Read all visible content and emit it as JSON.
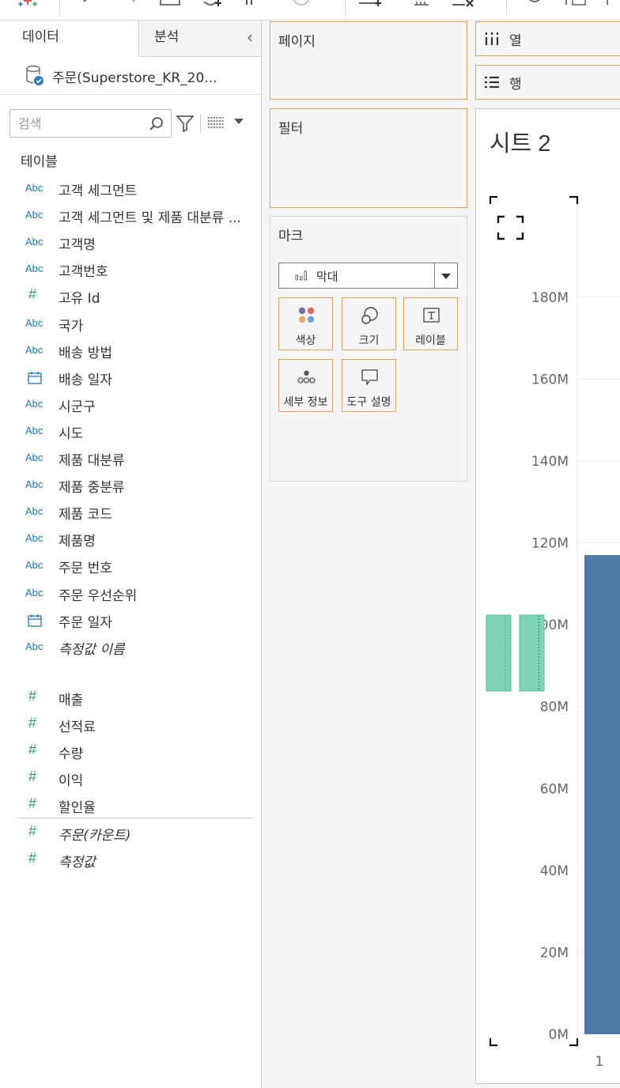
{
  "data_pane": {
    "tab_data": "데이터",
    "tab_analysis": "분석",
    "collapse_icon": "chevron-left-icon",
    "datasource_name": "주문(Superstore_KR_20...",
    "search_placeholder": "검색",
    "tables_heading": "테이블",
    "fields": [
      {
        "type": "Abc",
        "label": "고객 세그먼트",
        "italic": false
      },
      {
        "type": "Abc",
        "label": "고객 세그먼트 및 제품 대분류 ...",
        "italic": false
      },
      {
        "type": "Abc",
        "label": "고객명",
        "italic": false
      },
      {
        "type": "Abc",
        "label": "고객번호",
        "italic": false
      },
      {
        "type": "#",
        "label": "고유 Id",
        "italic": false
      },
      {
        "type": "Abc",
        "label": "국가",
        "italic": false
      },
      {
        "type": "Abc",
        "label": "배송 방법",
        "italic": false
      },
      {
        "type": "date",
        "label": "배송 일자",
        "italic": false
      },
      {
        "type": "Abc",
        "label": "시군구",
        "italic": false
      },
      {
        "type": "Abc",
        "label": "시도",
        "italic": false
      },
      {
        "type": "Abc",
        "label": "제품 대분류",
        "italic": false
      },
      {
        "type": "Abc",
        "label": "제품 중분류",
        "italic": false
      },
      {
        "type": "Abc",
        "label": "제품 코드",
        "italic": false
      },
      {
        "type": "Abc",
        "label": "제품명",
        "italic": false
      },
      {
        "type": "Abc",
        "label": "주문 번호",
        "italic": false
      },
      {
        "type": "Abc",
        "label": "주문 우선순위",
        "italic": false
      },
      {
        "type": "date",
        "label": "주문 일자",
        "italic": false
      },
      {
        "type": "Abc",
        "label": "측정값 이름",
        "italic": true
      }
    ],
    "measures": [
      {
        "type": "#",
        "label": "매출",
        "italic": false
      },
      {
        "type": "#",
        "label": "선적료",
        "italic": false
      },
      {
        "type": "#",
        "label": "수량",
        "italic": false
      },
      {
        "type": "#",
        "label": "이익",
        "italic": false
      },
      {
        "type": "#",
        "label": "할인율",
        "italic": false
      },
      {
        "type": "#",
        "label": "주문(카운트)",
        "italic": true
      },
      {
        "type": "#",
        "label": "측정값",
        "italic": true
      }
    ]
  },
  "cards": {
    "pages": "페이지",
    "filters": "필터",
    "marks": "마크",
    "mark_type": "막대",
    "mark_buttons": {
      "color": "색상",
      "size": "크기",
      "label": "레이블",
      "detail": "세부 정보",
      "tooltip": "도구 설명"
    }
  },
  "shelves": {
    "columns": "열",
    "rows": "행"
  },
  "sheet": {
    "title": "시트 2"
  },
  "colors": {
    "accent_orange": "#e3a15b",
    "bar_blue": "#4e79a7",
    "drop_green": "#7fd3b8"
  },
  "chart_data": {
    "type": "bar",
    "categories": [
      "1"
    ],
    "values": [
      117
    ],
    "value_unit": "M",
    "ylim": [
      0,
      190
    ],
    "yticks": [
      0,
      20,
      40,
      60,
      80,
      100,
      120,
      140,
      160,
      180
    ],
    "ytick_labels": [
      "0M",
      "20M",
      "40M",
      "60M",
      "80M",
      "100M",
      "120M",
      "140M",
      "160M",
      "180M"
    ],
    "grid": true
  }
}
